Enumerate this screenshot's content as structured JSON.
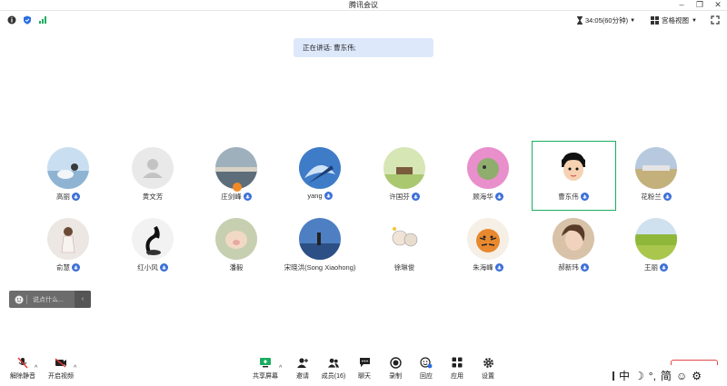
{
  "window": {
    "title": "腾讯会议"
  },
  "toolbar": {
    "timer": "34:05(60分钟)",
    "view_label": "宫格视图"
  },
  "banner": {
    "speaking_prefix": "正在讲话: ",
    "speaking_name": "曹东伟;"
  },
  "participants": [
    {
      "name": "高丽",
      "mic": "blue"
    },
    {
      "name": "黄文芳",
      "mic": "none"
    },
    {
      "name": "庄剑峰",
      "mic": "blue"
    },
    {
      "name": "yang",
      "mic": "blue"
    },
    {
      "name": "许国芬",
      "mic": "blue"
    },
    {
      "name": "顾海华",
      "mic": "blue"
    },
    {
      "name": "曹东伟",
      "mic": "blue"
    },
    {
      "name": "花粉兰",
      "mic": "blue"
    },
    {
      "name": "俞慧",
      "mic": "blue"
    },
    {
      "name": "红小风",
      "mic": "blue"
    },
    {
      "name": "潘毅",
      "mic": "none"
    },
    {
      "name": "宋晓洪(Song Xiaohong)",
      "mic": "none"
    },
    {
      "name": "徐琳俊",
      "mic": "none"
    },
    {
      "name": "朱海峰",
      "mic": "blue"
    },
    {
      "name": "郝新玮",
      "mic": "blue"
    },
    {
      "name": "王丽",
      "mic": "blue"
    }
  ],
  "chat": {
    "placeholder": "说点什么..."
  },
  "bottom": {
    "unmute": "解除静音",
    "video": "开启视频",
    "share": "共享屏幕",
    "invite": "邀请",
    "members": "成员(16)",
    "chat": "聊天",
    "record": "录制",
    "react": "回应",
    "apps": "应用",
    "settings": "设置"
  },
  "ime": {
    "lang": "中",
    "punct": "°,",
    "mode": "简"
  },
  "colors": {
    "accent": "#3a6fd8",
    "speaking_border": "#1aad5e",
    "banner_bg": "#dde8fb"
  }
}
